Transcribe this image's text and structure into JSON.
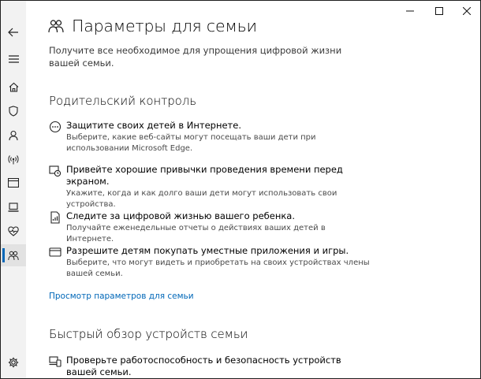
{
  "window": {
    "controls": {
      "minimize": "—",
      "maximize": "☐",
      "close": "✕"
    }
  },
  "rail": {
    "items": [
      {
        "icon": "back-arrow-icon"
      },
      {
        "icon": "hamburger-menu-icon"
      },
      {
        "icon": "home-icon"
      },
      {
        "icon": "shield-icon"
      },
      {
        "icon": "person-icon"
      },
      {
        "icon": "wireless-icon"
      },
      {
        "icon": "app-browser-icon"
      },
      {
        "icon": "laptop-icon"
      },
      {
        "icon": "heart-icon"
      },
      {
        "icon": "family-icon",
        "selected": true
      },
      {
        "icon": "gear-icon"
      }
    ]
  },
  "page": {
    "title": "Параметры для семьи",
    "subtitle": "Получите все необходимое для упрощения цифровой жизни вашей семьи."
  },
  "parental": {
    "title": "Родительский контроль",
    "items": [
      {
        "icon": "globe-icon",
        "heading": "Защитите своих детей в Интернете.",
        "desc": "Выберите, какие веб-сайты могут посещать ваши дети при использовании Microsoft Edge."
      },
      {
        "icon": "screen-time-icon",
        "heading": "Привейте хорошие привычки проведения времени перед экраном.",
        "desc": "Укажите, когда и как долго ваши дети могут использовать свои устройства."
      },
      {
        "icon": "activity-report-icon",
        "heading": "Следите за цифровой жизнью вашего ребенка.",
        "desc": "Получайте еженедельные отчеты о действиях ваших детей в Интернете."
      },
      {
        "icon": "payment-card-icon",
        "heading": "Разрешите детям покупать уместные приложения и игры.",
        "desc": "Выберите, что могут видеть и приобретать на своих устройствах члены вашей семьи."
      }
    ],
    "link": "Просмотр параметров для семьи"
  },
  "devices": {
    "title": "Быстрый обзор устройств семьи",
    "items": [
      {
        "icon": "devices-icon",
        "heading": "Проверьте работоспособность и безопасность устройств вашей семьи."
      }
    ]
  }
}
